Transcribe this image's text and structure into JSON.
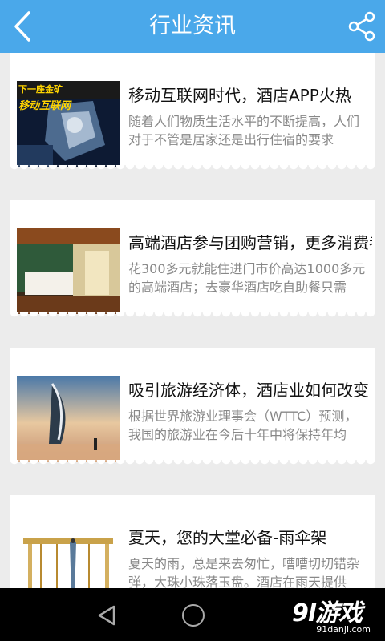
{
  "header": {
    "title": "行业资讯",
    "back_icon": "back-chevron-icon",
    "share_icon": "share-icon",
    "bg_color": "#4aa8ea"
  },
  "articles": [
    {
      "title": "移动互联网时代，酒店APP火热",
      "desc": "随着人们物质生活水平的不断提高，人们对于不管是居家还是出行住宿的要求",
      "thumb_text_1": "下一座金矿",
      "thumb_text_2": "移动互联网"
    },
    {
      "title": "高端酒店参与团购营销，更多消费者",
      "desc": "花300多元就能住进门市价高达1000多元的高端酒店；去豪华酒店吃自助餐只需"
    },
    {
      "title": "吸引旅游经济体，酒店业如何改变",
      "desc": "根据世界旅游业理事会（WTTC）预测，我国的旅游业在今后十年中将保持年均"
    },
    {
      "title": "夏天，您的大堂必备-雨伞架",
      "desc": "夏天的雨，总是来去匆忙，嘈嘈切切错杂弹，大珠小珠落玉盘。酒店在雨天提供"
    }
  ],
  "navbar": {
    "back_icon": "nav-back-icon",
    "home_icon": "nav-home-icon"
  },
  "watermark": {
    "text": "9l游戏",
    "url": "91danji.com"
  }
}
